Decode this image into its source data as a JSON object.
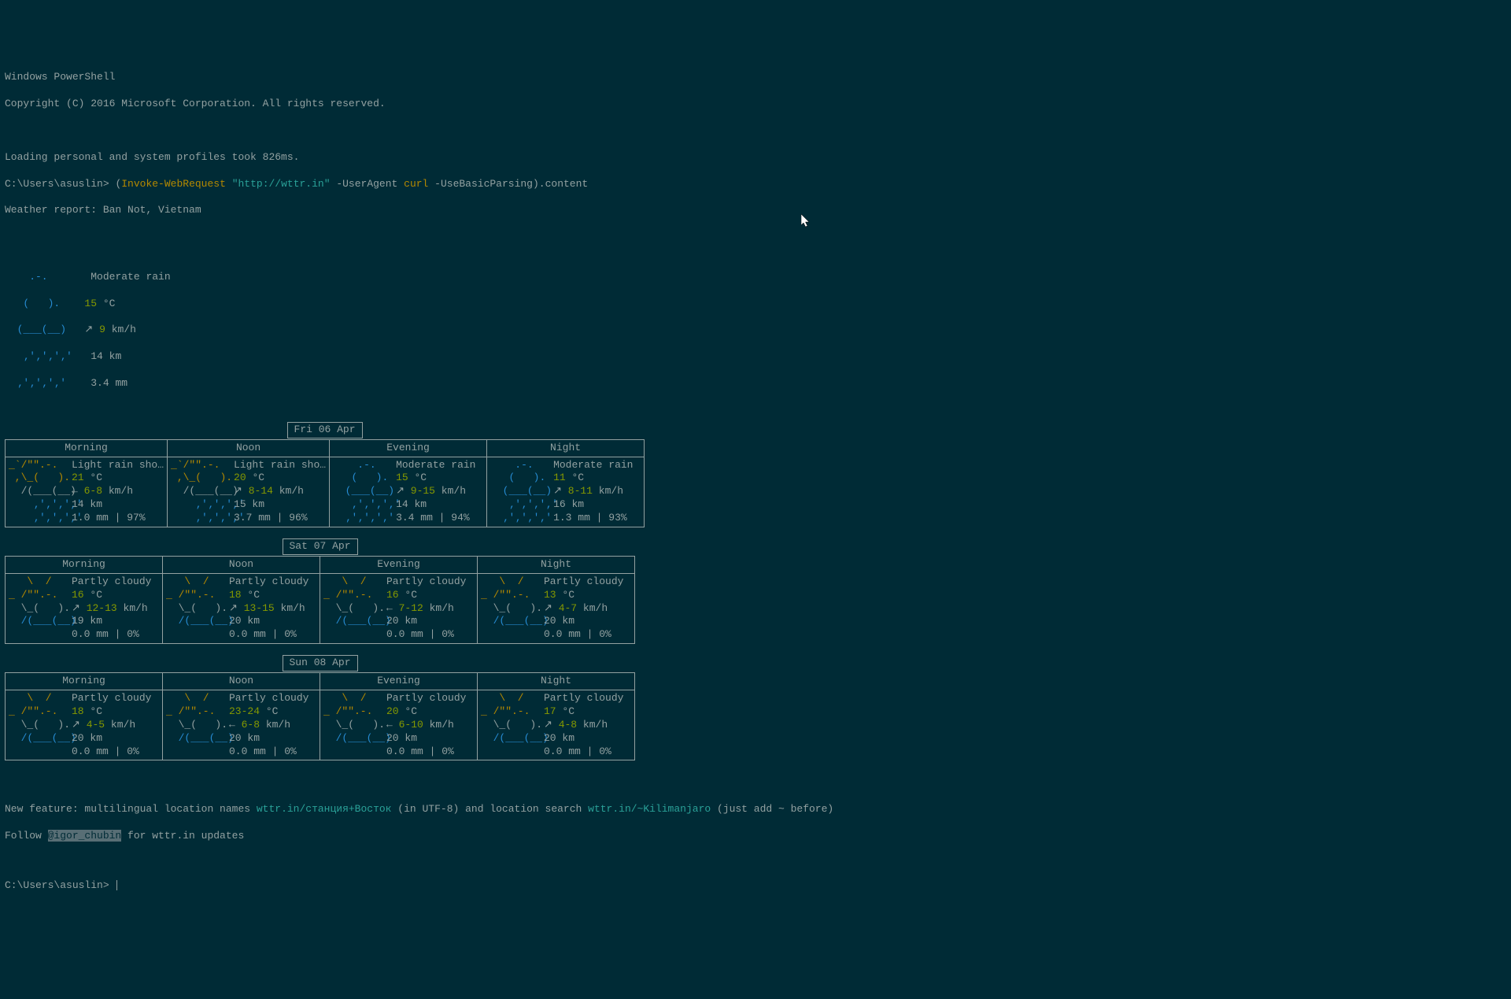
{
  "header": {
    "title": "Windows PowerShell",
    "copyright": "Copyright (C) 2016 Microsoft Corporation. All rights reserved.",
    "loading": "Loading personal and system profiles took 826ms.",
    "prompt": "C:\\Users\\asuslin>",
    "cmd_open": "(",
    "cmd_invoke": "Invoke-WebRequest",
    "cmd_url": "\"http://wttr.in\"",
    "cmd_ua_flag": " -UserAgent",
    "cmd_curl": " curl",
    "cmd_basic": " -UseBasicParsing",
    "cmd_close": ").content",
    "report": "Weather report: Ban Not, Vietnam"
  },
  "current": {
    "art1": "    .-.    ",
    "art2": "   (   ). ",
    "art3": "  (___(__)",
    "art4": "   ‚'‚'‚'‚'",
    "art5": "  ‚'‚'‚'‚' ",
    "cond": "Moderate rain",
    "temp": "15",
    "tempu": " °C",
    "wind_arrow": "↗ ",
    "wind_val": "9",
    "wind_unit": " km/h",
    "vis": "14 km",
    "precip": "3.4 mm"
  },
  "days": [
    {
      "date": "Fri 06 Apr",
      "parts": [
        "Morning",
        "Noon",
        "Evening",
        "Night"
      ],
      "cells": [
        {
          "art": [
            "_`/\"\".-.   ",
            " ,\\_(   ). ",
            "  /(___(__)",
            "    ‚'‚'‚'‚'",
            "    ‚'‚'‚'‚'"
          ],
          "artcol": "yellow",
          "cond": "Light rain sho…",
          "temp": "21",
          "wind_arrow": "← ",
          "wind": "6-8",
          "vis": "14 km",
          "precip": "1.0 mm | 97%"
        },
        {
          "art": [
            "_`/\"\".-.   ",
            " ,\\_(   ). ",
            "  /(___(__)",
            "    ‚'‚'‚'‚'",
            "    ‚'‚'‚'‚'"
          ],
          "artcol": "yellow",
          "cond": "Light rain sho…",
          "temp": "20",
          "wind_arrow": "↗ ",
          "wind": "8-14",
          "vis": "15 km",
          "precip": "3.7 mm | 96%"
        },
        {
          "art": [
            "    .-.    ",
            "   (   ). ",
            "  (___(__)",
            "   ‚'‚'‚'‚'",
            "  ‚'‚'‚'‚' "
          ],
          "artcol": "blue",
          "cond": "Moderate rain",
          "temp": "15",
          "wind_arrow": "↗ ",
          "wind": "9-15",
          "vis": "14 km",
          "precip": "3.4 mm | 94%"
        },
        {
          "art": [
            "    .-.    ",
            "   (   ). ",
            "  (___(__)",
            "   ‚'‚'‚'‚'",
            "  ‚'‚'‚'‚' "
          ],
          "artcol": "blue",
          "cond": "Moderate rain",
          "temp": "11",
          "wind_arrow": "↗ ",
          "wind": "8-11",
          "vis": "16 km",
          "precip": "1.3 mm | 93%"
        }
      ]
    },
    {
      "date": "Sat 07 Apr",
      "parts": [
        "Morning",
        "Noon",
        "Evening",
        "Night"
      ],
      "cells": [
        {
          "art": [
            "   \\  /    ",
            "_ /\"\".-.   ",
            "  \\_(   ). ",
            "  /(___(__)",
            "           "
          ],
          "artcol": "yellow",
          "cond": "Partly cloudy",
          "temp": "16",
          "wind_arrow": "↗ ",
          "wind": "12-13",
          "vis": "19 km",
          "precip": "0.0 mm | 0%"
        },
        {
          "art": [
            "   \\  /    ",
            "_ /\"\".-.   ",
            "  \\_(   ). ",
            "  /(___(__)",
            "           "
          ],
          "artcol": "yellow",
          "cond": "Partly cloudy",
          "temp": "18",
          "wind_arrow": "↗ ",
          "wind": "13-15",
          "vis": "20 km",
          "precip": "0.0 mm | 0%"
        },
        {
          "art": [
            "   \\  /    ",
            "_ /\"\".-.   ",
            "  \\_(   ). ",
            "  /(___(__)",
            "           "
          ],
          "artcol": "yellow",
          "cond": "Partly cloudy",
          "temp": "16",
          "wind_arrow": "← ",
          "wind": "7-12",
          "vis": "20 km",
          "precip": "0.0 mm | 0%"
        },
        {
          "art": [
            "   \\  /    ",
            "_ /\"\".-.   ",
            "  \\_(   ). ",
            "  /(___(__)",
            "           "
          ],
          "artcol": "yellow",
          "cond": "Partly cloudy",
          "temp": "13",
          "wind_arrow": "↗ ",
          "wind": "4-7",
          "vis": "20 km",
          "precip": "0.0 mm | 0%"
        }
      ]
    },
    {
      "date": "Sun 08 Apr",
      "parts": [
        "Morning",
        "Noon",
        "Evening",
        "Night"
      ],
      "cells": [
        {
          "art": [
            "   \\  /    ",
            "_ /\"\".-.   ",
            "  \\_(   ). ",
            "  /(___(__)",
            "           "
          ],
          "artcol": "yellow",
          "cond": "Partly cloudy",
          "temp": "18",
          "wind_arrow": "↗ ",
          "wind": "4-5",
          "vis": "20 km",
          "precip": "0.0 mm | 0%"
        },
        {
          "art": [
            "   \\  /    ",
            "_ /\"\".-.   ",
            "  \\_(   ). ",
            "  /(___(__)",
            "           "
          ],
          "artcol": "yellow",
          "cond": "Partly cloudy",
          "temp": "23-24",
          "wind_arrow": "← ",
          "wind": "6-8",
          "vis": "20 km",
          "precip": "0.0 mm | 0%"
        },
        {
          "art": [
            "   \\  /    ",
            "_ /\"\".-.   ",
            "  \\_(   ). ",
            "  /(___(__)",
            "           "
          ],
          "artcol": "yellow",
          "cond": "Partly cloudy",
          "temp": "20",
          "wind_arrow": "← ",
          "wind": "6-10",
          "vis": "20 km",
          "precip": "0.0 mm | 0%"
        },
        {
          "art": [
            "   \\  /    ",
            "_ /\"\".-.   ",
            "  \\_(   ). ",
            "  /(___(__)",
            "           "
          ],
          "artcol": "yellow",
          "cond": "Partly cloudy",
          "temp": "17",
          "wind_arrow": "↗ ",
          "wind": "4-8",
          "vis": "20 km",
          "precip": "0.0 mm | 0%"
        }
      ]
    }
  ],
  "footer": {
    "feature_pre": "New feature: multilingual location names ",
    "link1": "wttr.in/станция+Восток",
    "feature_mid": " (in UTF-8) and location search ",
    "link2": "wttr.in/~Kilimanjaro",
    "feature_post": " (just add ~ before)",
    "follow_pre": "Follow ",
    "handle": "@igor_chubin",
    "follow_post": " for wttr.in updates"
  },
  "prompt2": "C:\\Users\\asuslin>"
}
